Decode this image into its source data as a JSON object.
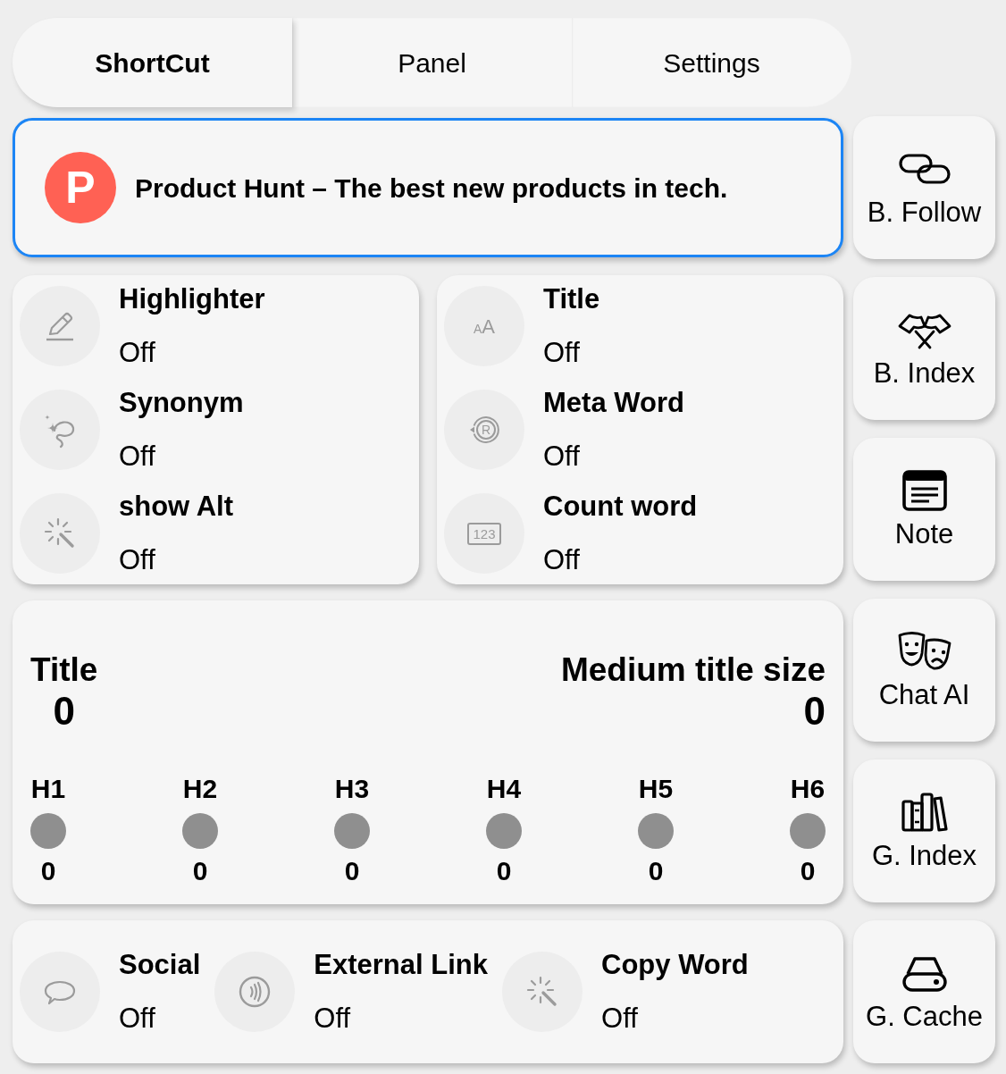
{
  "tabs": [
    {
      "label": "ShortCut",
      "selected": true
    },
    {
      "label": "Panel",
      "selected": false
    },
    {
      "label": "Settings",
      "selected": false
    }
  ],
  "page_card": {
    "logo": "P",
    "title": "Product Hunt – The best new products in tech."
  },
  "toggle_groups": [
    {
      "items": [
        {
          "label": "Highlighter",
          "value": "Off",
          "on": false
        },
        {
          "label": "Synonym",
          "value": "Off",
          "on": false
        },
        {
          "label": "show Alt",
          "value": "Off",
          "on": false
        }
      ]
    },
    {
      "items": [
        {
          "label": "Title",
          "value": "Off",
          "on": false,
          "icon_text": "AA"
        },
        {
          "label": "Meta Word",
          "value": "Off",
          "on": false,
          "icon_text": "R"
        },
        {
          "label": "Count word",
          "value": "Off",
          "on": false,
          "icon_text": "123"
        }
      ]
    }
  ],
  "heading_stats": {
    "title": {
      "label": "Title",
      "value": "0"
    },
    "medium_title": {
      "label": "Medium title size",
      "value": "0"
    },
    "headings": [
      {
        "label": "H1",
        "value": "0"
      },
      {
        "label": "H2",
        "value": "0"
      },
      {
        "label": "H3",
        "value": "0"
      },
      {
        "label": "H4",
        "value": "0"
      },
      {
        "label": "H5",
        "value": "0"
      },
      {
        "label": "H6",
        "value": "0"
      }
    ]
  },
  "link_toggles": [
    {
      "label": "Social",
      "value": "Off",
      "on": false
    },
    {
      "label": "External Link",
      "value": "Off",
      "on": false
    },
    {
      "label": "Copy Word",
      "value": "Off",
      "on": false
    }
  ],
  "side_buttons": [
    {
      "label": "B. Follow"
    },
    {
      "label": "B. Index"
    },
    {
      "label": "Note"
    },
    {
      "label": "Chat AI"
    },
    {
      "label": "G. Index"
    },
    {
      "label": "G. Cache"
    }
  ]
}
